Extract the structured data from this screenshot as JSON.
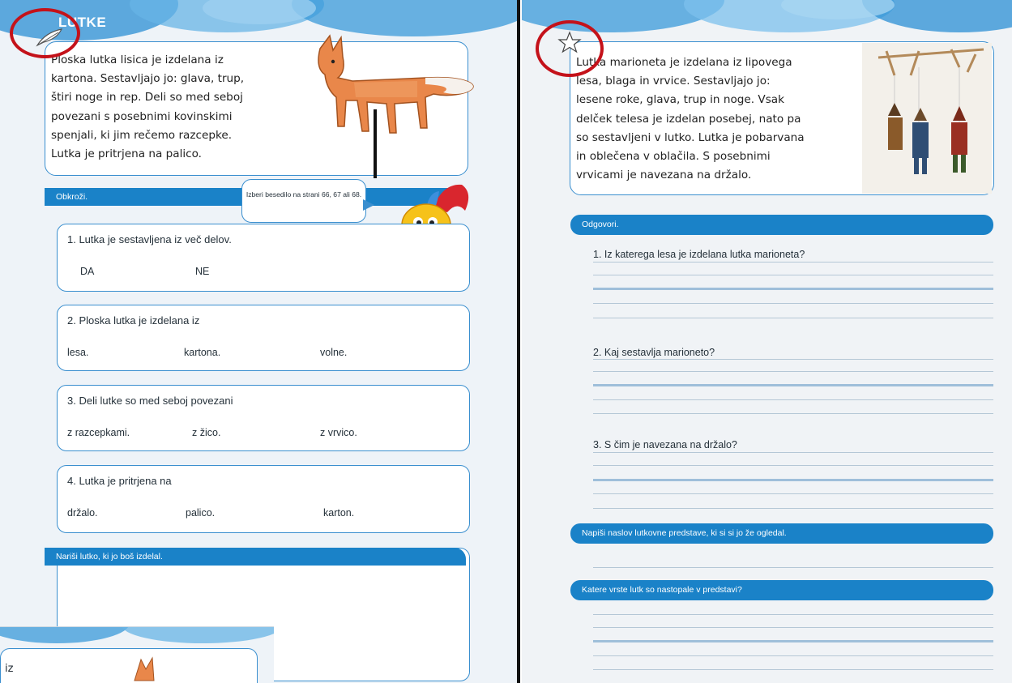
{
  "left_page": {
    "title": "LUTKE",
    "intro_lines": [
      "Ploska lutka lisica je izdelana iz",
      "kartona. Sestavljajo jo: glava, trup,",
      "štiri noge in rep. Deli so med seboj",
      "povezani s posebnimi kovinskimi",
      "spenjali, ki jim rečemo razcepke.",
      "Lutka je pritrjena na palico."
    ],
    "task_band": "Obkroži.",
    "speech_bubble": "Izberi besedilo na strani 66, 67 ali 68.",
    "questions": [
      {
        "text": "1. Lutka je sestavljena iz več delov.",
        "options": [
          "DA",
          "NE"
        ]
      },
      {
        "text": "2. Ploska lutka je izdelana iz",
        "options": [
          "lesa.",
          "kartona.",
          "volne."
        ]
      },
      {
        "text": "3. Deli lutke so med seboj povezani",
        "options": [
          "z razcepkami.",
          "z žico.",
          "z vrvico."
        ]
      },
      {
        "text": "4. Lutka je pritrjena na",
        "options": [
          "držalo.",
          "palico.",
          "karton."
        ]
      }
    ],
    "draw_band": "Nariši lutko, ki jo boš izdelal.",
    "inset_text": "iz"
  },
  "right_page": {
    "intro_lines": [
      "Lutka marioneta je izdelana iz lipovega",
      "lesa, blaga in vrvice. Sestavljajo jo:",
      "lesene roke, glava, trup in noge. Vsak",
      "delček telesa je izdelan posebej, nato pa",
      "so sestavljeni v lutko. Lutka je pobarvana",
      "in oblečena v oblačila. S posebnimi",
      "vrvicami je navezana na držalo."
    ],
    "answer_band": "Odgovori.",
    "questions": [
      "1. Iz katerega lesa je izdelana lutka marioneta?",
      "2. Kaj sestavlja marioneto?",
      "3. S čim je navezana na držalo?"
    ],
    "title_band": "Napiši naslov lutkovne predstave, ki si si jo že ogledal.",
    "types_band": "Katere vrste lutk so nastopale v predstavi?"
  },
  "colors": {
    "accent_blue": "#1a82c8",
    "annotation_red": "#c4121a",
    "box_border": "#3a8fcf"
  },
  "icons": [
    "feather-icon",
    "star-icon"
  ]
}
